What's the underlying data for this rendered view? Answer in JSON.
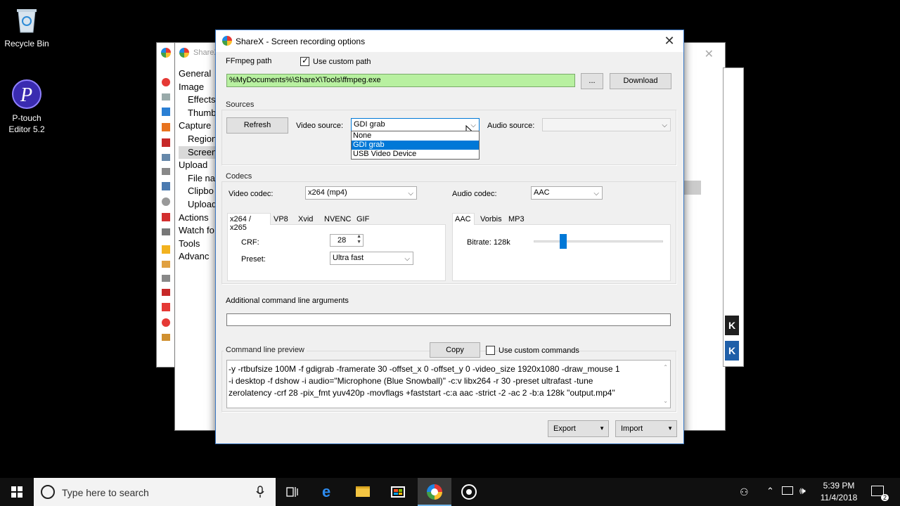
{
  "desktop": {
    "icons": [
      {
        "label": "Recycle Bin",
        "icon": "recycle-bin-icon"
      },
      {
        "label": "P-touch Editor 5.2",
        "icon": "ptouch-editor-icon"
      }
    ]
  },
  "background_window": {
    "title": "ShareX",
    "sidebar": [
      "General",
      "Image",
      "Effects",
      "Thumb",
      "Capture",
      "Region",
      "Screen",
      "Upload",
      "File na",
      "Clipbo",
      "Upload",
      "Actions",
      "Watch fo",
      "Tools",
      "Advanc"
    ]
  },
  "dialog": {
    "title": "ShareX - Screen recording options",
    "ffmpeg": {
      "label": "FFmpeg path",
      "use_custom_path_label": "Use custom path",
      "use_custom_path_checked": true,
      "path_value": "%MyDocuments%\\ShareX\\Tools\\ffmpeg.exe",
      "browse_label": "...",
      "download_label": "Download"
    },
    "sources": {
      "label": "Sources",
      "refresh_label": "Refresh",
      "video_source_label": "Video source:",
      "video_source_value": "GDI grab",
      "video_source_options": [
        "None",
        "GDI grab",
        "USB Video Device"
      ],
      "audio_source_label": "Audio source:",
      "audio_source_value": ""
    },
    "codecs": {
      "label": "Codecs",
      "video_codec_label": "Video codec:",
      "video_codec_value": "x264 (mp4)",
      "audio_codec_label": "Audio codec:",
      "audio_codec_value": "AAC",
      "video_tabs": [
        "x264 / x265",
        "VP8",
        "Xvid",
        "NVENC",
        "GIF"
      ],
      "crf_label": "CRF:",
      "crf_value": "28",
      "preset_label": "Preset:",
      "preset_value": "Ultra fast",
      "audio_tabs": [
        "AAC",
        "Vorbis",
        "MP3"
      ],
      "bitrate_label": "Bitrate: 128k",
      "bitrate_fraction": 0.21
    },
    "additional_args": {
      "label": "Additional command line arguments",
      "value": ""
    },
    "preview": {
      "label": "Command line preview",
      "copy_label": "Copy",
      "use_custom_commands_label": "Use custom commands",
      "use_custom_commands_checked": false,
      "lines": [
        "-y -rtbufsize 100M -f gdigrab -framerate 30 -offset_x 0 -offset_y 0 -video_size 1920x1080 -draw_mouse 1",
        "-i desktop -f dshow -i audio=\"Microphone (Blue Snowball)\" -c:v libx264 -r 30 -preset ultrafast -tune",
        "zerolatency -crf 28 -pix_fmt yuv420p -movflags +faststart -c:a aac -strict -2 -ac 2 -b:a 128k \"output.mp4\""
      ]
    },
    "export_label": "Export",
    "import_label": "Import"
  },
  "taskbar": {
    "search_placeholder": "Type here to search",
    "time": "5:39 PM",
    "date": "11/4/2018",
    "notification_count": "2"
  },
  "colors": {
    "accent": "#0078d7",
    "path_ok": "#b8f0a0",
    "taskbar": "#101010"
  }
}
